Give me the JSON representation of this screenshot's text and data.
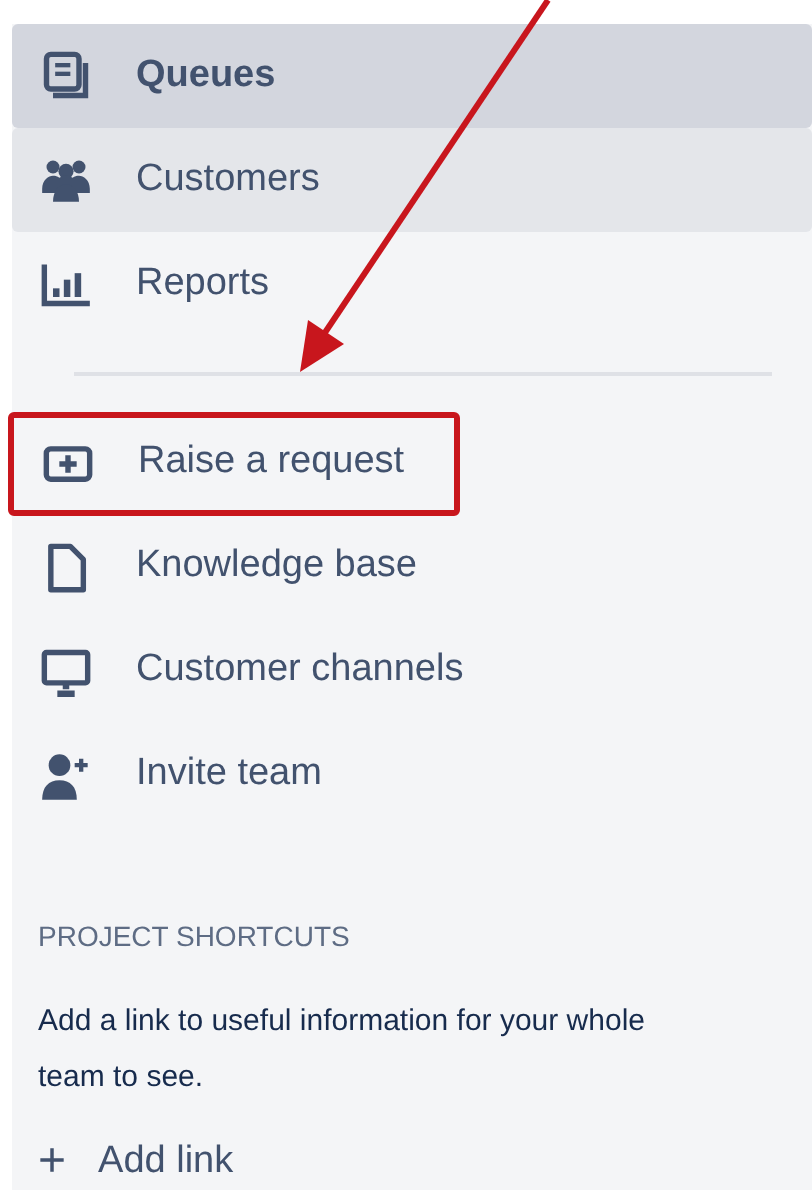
{
  "nav_items": [
    {
      "label": "Queues",
      "selected": true,
      "hovered": false,
      "annotated": false
    },
    {
      "label": "Customers",
      "selected": false,
      "hovered": true,
      "annotated": false
    },
    {
      "label": "Reports",
      "selected": false,
      "hovered": false,
      "annotated": false
    }
  ],
  "tool_items": [
    {
      "label": "Raise a request",
      "annotated": true
    },
    {
      "label": "Knowledge base",
      "annotated": false
    },
    {
      "label": "Customer channels",
      "annotated": false
    },
    {
      "label": "Invite team",
      "annotated": false
    }
  ],
  "shortcuts": {
    "heading": "PROJECT SHORTCUTS",
    "description": "Add a link to useful information for your whole team to see.",
    "add_link": {
      "icon": "+",
      "label": "Add link"
    }
  }
}
